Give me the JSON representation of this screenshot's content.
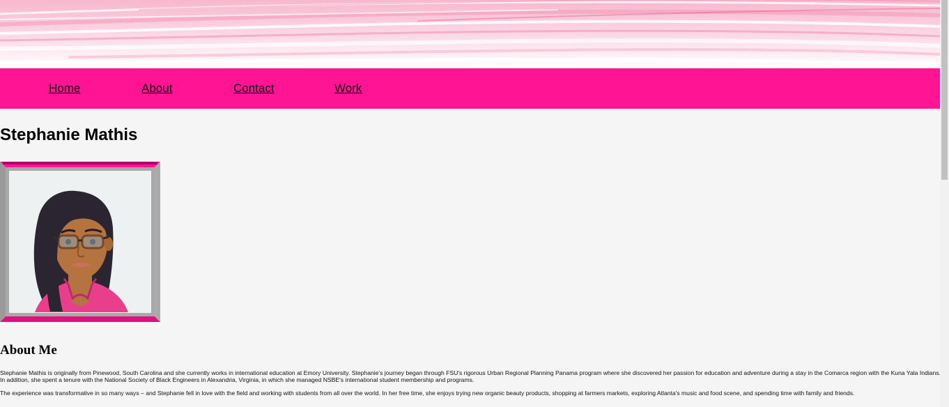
{
  "banner": {
    "colors": {
      "base": "#fbe3ee",
      "streak": "#f48fb1",
      "light": "#ffffff"
    }
  },
  "nav": {
    "background": "#ff1493",
    "items": [
      {
        "label": "Home"
      },
      {
        "label": "About"
      },
      {
        "label": "Contact"
      },
      {
        "label": "Work"
      }
    ]
  },
  "header": {
    "name": "Stephanie Mathis"
  },
  "profile": {
    "avatar": "cartoon-woman-portrait",
    "frame_colors": {
      "border": "#ff1493",
      "bevel": "#999999",
      "inner": "#eef1f2"
    }
  },
  "about": {
    "heading": "About Me",
    "paragraphs": [
      "Stephanie Mathis is originally from Pinewood, South Carolina and she currently works in international education at Emory University. Stephanie's journey began through FSU's rigorous Urban Regional Planning Panama program where she discovered her passion for education and adventure during a stay in the Comarca region with the Kuna Yala Indians. In addition, she spent a tenure with the National Society of Black Engineers in Alexandria, Virginia, in which she managed NSBE's international student membership and programs.",
      "The experience was transformative in so many ways – and Stephanie fell in love with the field and working with students from all over the world. In her free time, she enjoys trying new organic beauty products, shopping at farmers markets, exploring Atlanta's music and food scene, and spending time with family and friends."
    ]
  }
}
